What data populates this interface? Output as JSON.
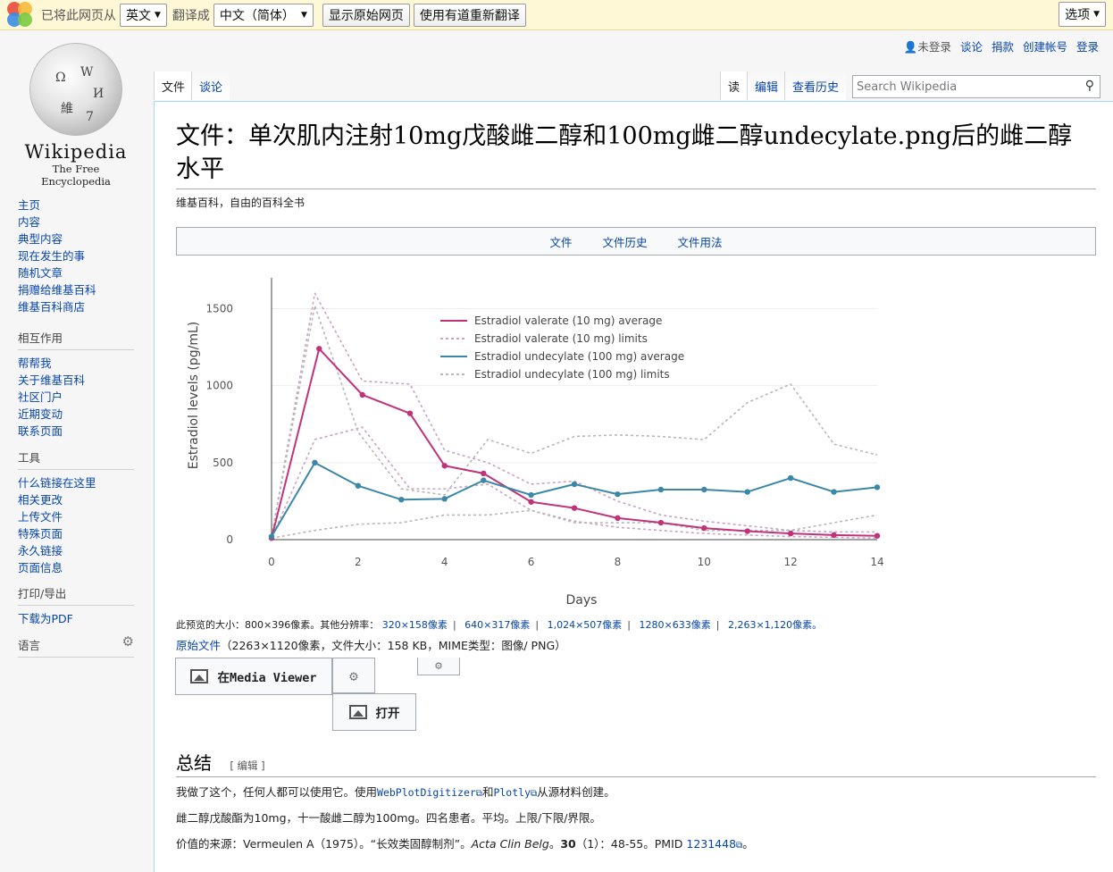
{
  "translate_bar": {
    "prefix": "已将此网页从",
    "source_lang": "英文",
    "middle": "翻译成",
    "target_lang": "中文（简体）",
    "show_original": "显示原始网页",
    "retranslate": "使用有道重新翻译",
    "options": "选项"
  },
  "logo": {
    "wordmark": "Wikipedia",
    "tagline": "The Free Encyclopedia"
  },
  "sidebar": {
    "nav": [
      "主页",
      "内容",
      "典型内容",
      "现在发生的事",
      "随机文章",
      "捐赠给维基百科",
      "维基百科商店"
    ],
    "interaction": {
      "head": "相互作用",
      "items": [
        "帮帮我",
        "关于维基百科",
        "社区门户",
        "近期变动",
        "联系页面"
      ]
    },
    "tools": {
      "head": "工具",
      "items": [
        "什么链接在这里",
        "相关更改",
        "上传文件",
        "特殊页面",
        "永久链接",
        "页面信息"
      ]
    },
    "print": {
      "head": "打印/导出",
      "items": [
        "下载为PDF"
      ]
    },
    "languages": {
      "head": "语言"
    }
  },
  "personal": {
    "not_logged_in": "未登录",
    "talk": "谈论",
    "donate": "捐款",
    "create_account": "创建帐号",
    "login": "登录"
  },
  "tabs": {
    "file": "文件",
    "talk": "谈论",
    "read": "读",
    "edit": "编辑",
    "history": "查看历史"
  },
  "search": {
    "placeholder": "Search Wikipedia"
  },
  "page": {
    "title": "文件：单次肌内注射10mg戊酸雌二醇和100mg雌二醇undecylate.png后的雌二醇水平",
    "tagline": "维基百科，自由的百科全书",
    "toc": [
      "文件",
      "文件历史",
      "文件用法"
    ],
    "preview_prefix": "此预览的大小：800×396像素。其他分辨率：",
    "resolutions": [
      "320×158像素",
      "640×317像素",
      "1,024×507像素",
      "1280×633像素",
      "2,263×1,120像素。"
    ],
    "original_link": "原始文件",
    "original_info": "（2263×1120像素，文件大小：158 KB，MIME类型：图像/ PNG）",
    "mv_button": "在Media Viewer",
    "open_button": "打开",
    "summary_title": "总结",
    "edit_bracket": "[ 编辑 ]",
    "p1_prefix": "我做了这个，任何人都可以使用它。使用",
    "p1_link1": "WebPlotDigitizer",
    "p1_mid": "和",
    "p1_link2": "Plotly",
    "p1_suffix": "从源材料创建。",
    "p2": "雌二醇戊酸酯为10mg，十一酸雌二醇为100mg。四名患者。平均。上限/下限/界限。",
    "p3_prefix": "价值的来源：Vermeulen A（1975）。“长效类固醇制剂”。",
    "p3_journal": "Acta Clin Belg",
    "p3_sep": "。",
    "p3_vol": "30",
    "p3_rest": "（1）：48-55。PMID ",
    "p3_pmid": "1231448",
    "p3_end": "。"
  },
  "chart_data": {
    "type": "line",
    "xlabel": "Days",
    "ylabel": "Estradiol levels (pg/mL)",
    "xlim": [
      0,
      14
    ],
    "ylim": [
      0,
      1700
    ],
    "xticks": [
      0,
      2,
      4,
      6,
      8,
      10,
      12,
      14
    ],
    "yticks": [
      0,
      500,
      1000,
      1500
    ],
    "grid": true,
    "legend_position": "top-right",
    "series": [
      {
        "name": "Estradiol valerate (10 mg) average",
        "color": "#c2327a",
        "dash": false,
        "x": [
          0,
          1.1,
          2.1,
          3.2,
          4,
          4.9,
          6,
          7,
          8,
          9,
          10,
          11,
          12,
          13,
          14
        ],
        "y": [
          10,
          1240,
          940,
          820,
          480,
          430,
          245,
          205,
          140,
          110,
          75,
          55,
          40,
          30,
          25
        ]
      },
      {
        "name": "Estradiol valerate (10 mg) limits",
        "color": "#c9a3c0",
        "dash": true,
        "x": [
          0,
          1,
          2.1,
          3.2,
          4,
          5,
          6,
          7,
          8,
          9,
          10,
          11,
          12,
          13,
          14
        ],
        "y": [
          20,
          1600,
          1030,
          1010,
          580,
          500,
          360,
          380,
          250,
          160,
          120,
          90,
          60,
          50,
          50
        ]
      },
      {
        "name": "Estradiol valerate (10 mg) limits",
        "color": "#c9a3c0",
        "dash": true,
        "x": [
          0,
          1,
          2.1,
          3.2,
          4,
          5,
          6,
          7,
          8,
          9,
          10,
          11,
          12,
          13,
          14
        ],
        "y": [
          10,
          650,
          730,
          330,
          330,
          360,
          190,
          120,
          80,
          60,
          40,
          30,
          20,
          15,
          10
        ]
      },
      {
        "name": "Estradiol undecylate (100 mg) average",
        "color": "#3a87a8",
        "dash": false,
        "x": [
          0,
          1,
          2,
          3,
          4,
          4.9,
          6,
          7,
          8,
          9,
          10,
          11,
          12,
          13,
          14
        ],
        "y": [
          20,
          500,
          350,
          260,
          265,
          385,
          290,
          360,
          295,
          325,
          325,
          310,
          400,
          310,
          340
        ]
      },
      {
        "name": "Estradiol undecylate (100 mg) limits",
        "color": "#b7b7b7",
        "dash": true,
        "x": [
          0,
          1,
          2,
          3,
          4,
          5,
          6,
          7,
          8,
          9,
          10,
          11,
          12,
          13,
          14
        ],
        "y": [
          20,
          1520,
          700,
          330,
          290,
          650,
          560,
          670,
          680,
          670,
          650,
          890,
          1010,
          620,
          550
        ]
      },
      {
        "name": "Estradiol undecylate (100 mg) limits",
        "color": "#b7b7b7",
        "dash": true,
        "x": [
          0,
          1,
          2,
          3,
          4,
          5,
          6,
          7,
          8,
          9,
          10,
          11,
          12,
          13,
          14
        ],
        "y": [
          10,
          60,
          100,
          110,
          160,
          160,
          190,
          110,
          110,
          110,
          60,
          60,
          60,
          110,
          160
        ]
      }
    ],
    "legend": [
      {
        "name": "Estradiol valerate (10 mg) average",
        "color": "#c2327a",
        "dash": false
      },
      {
        "name": "Estradiol valerate (10 mg) limits",
        "color": "#c9a3c0",
        "dash": true
      },
      {
        "name": "Estradiol undecylate (100 mg) average",
        "color": "#3a87a8",
        "dash": false
      },
      {
        "name": "Estradiol undecylate (100 mg) limits",
        "color": "#b7b7b7",
        "dash": true
      }
    ]
  }
}
